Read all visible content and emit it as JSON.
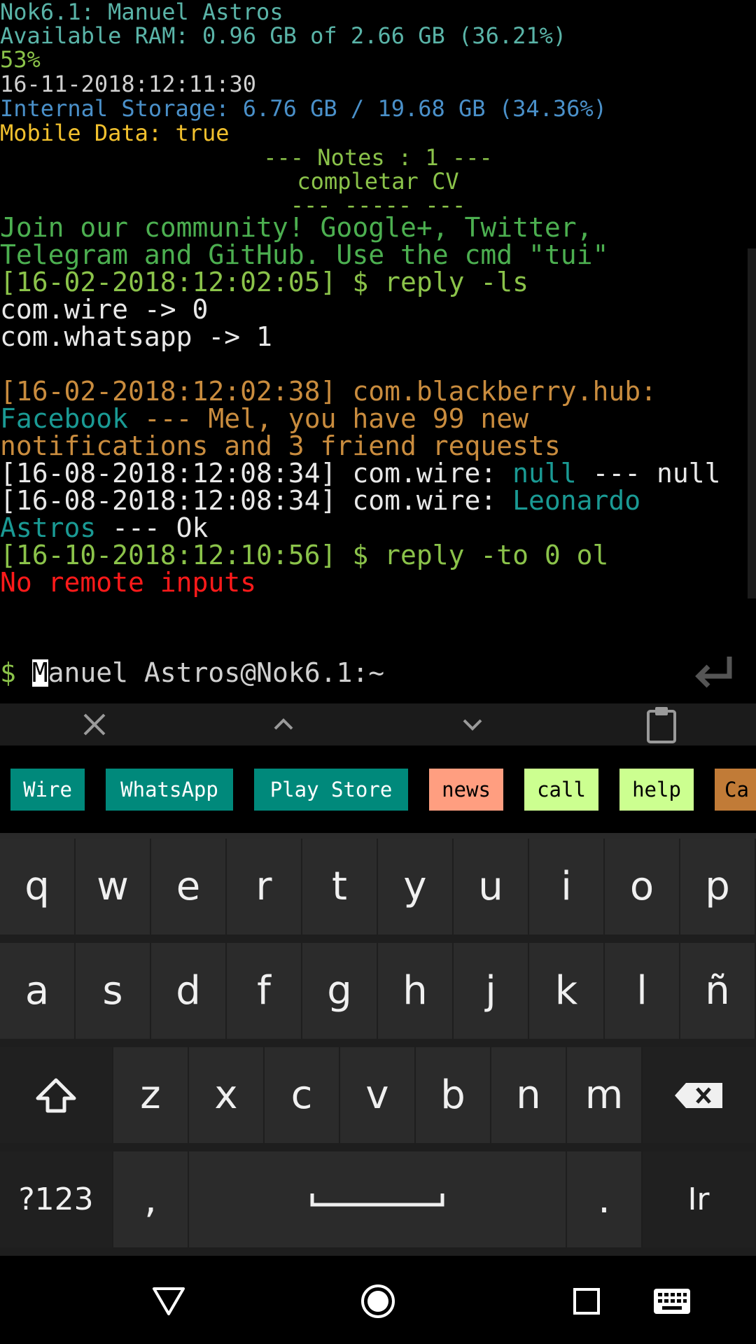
{
  "terminal": {
    "header": {
      "device": "Nok6.1: Manuel Astros",
      "ram": "Available RAM: 0.96 GB of 2.66 GB (36.21%)",
      "battery": "53%",
      "datetime": "16-11-2018:12:11:30",
      "storage": "Internal Storage: 6.76 GB / 19.68 GB (34.36%)",
      "mobile_data": "Mobile Data: true",
      "notes_title": "--- Notes : 1 ---",
      "notes_item": "completar CV",
      "notes_footer": "--- ----- ---"
    },
    "community_line1": "Join our community! Google+, Twitter,",
    "community_line2": "Telegram and GitHub. Use the cmd \"tui\"",
    "log": {
      "cmd1_ts": "[16-02-2018:12:02:05]",
      "cmd1": " $ reply -ls",
      "out1": "com.wire -> 0",
      "out2": "com.whatsapp -> 1",
      "n1_ts": "[16-02-2018:12:02:38]",
      "n1_app": " com.blackberry.hub:",
      "n1_title": "Facebook",
      "n1_sep": " --- Mel, you have 99 new",
      "n1_text2": "notifications and 3 friend requests",
      "n2_ts": "[16-08-2018:12:08:34]",
      "n2_app": " com.wire: ",
      "n2_title": "null",
      "n2_text": " --- null",
      "n3_ts": "[16-08-2018:12:08:34]",
      "n3_app": " com.wire: ",
      "n3_title1": "Leonardo",
      "n3_title2": "Astros",
      "n3_text": " --- Ok",
      "cmd2_ts": "[16-10-2018:12:10:56]",
      "cmd2": " $ reply -to 0 ol",
      "error": "No remote inputs"
    },
    "prompt": {
      "symbol": "$ ",
      "cursor_char": "M",
      "rest": "anuel Astros@Nok6.1:~"
    }
  },
  "app_shortcuts": [
    {
      "label": "Wire",
      "bg": "#00897b",
      "fg": "#ffffff"
    },
    {
      "label": "WhatsApp",
      "bg": "#00897b",
      "fg": "#ffffff"
    },
    {
      "label": "Play Store",
      "bg": "#00897b",
      "fg": "#ffffff"
    },
    {
      "label": "news",
      "bg": "#ff9e80",
      "fg": "#000000"
    },
    {
      "label": "call",
      "bg": "#ccff90",
      "fg": "#000000"
    },
    {
      "label": "help",
      "bg": "#ccff90",
      "fg": "#000000"
    },
    {
      "label": "Ca",
      "bg": "#c17b37",
      "fg": "#000000"
    }
  ],
  "keyboard": {
    "row1": [
      "q",
      "w",
      "e",
      "r",
      "t",
      "y",
      "u",
      "i",
      "o",
      "p"
    ],
    "row2": [
      "a",
      "s",
      "d",
      "f",
      "g",
      "h",
      "j",
      "k",
      "l",
      "ñ"
    ],
    "row3": [
      "z",
      "x",
      "c",
      "v",
      "b",
      "n",
      "m"
    ],
    "symbols_key": "?123",
    "comma_key": ",",
    "period_key": ".",
    "lang_key": "Ir"
  },
  "icons": [
    "enter-icon",
    "close-icon",
    "chevron-up-icon",
    "chevron-down-icon",
    "clipboard-icon",
    "shift-icon",
    "backspace-icon",
    "space-icon",
    "back-icon",
    "home-icon",
    "recents-icon",
    "keyboard-icon"
  ]
}
